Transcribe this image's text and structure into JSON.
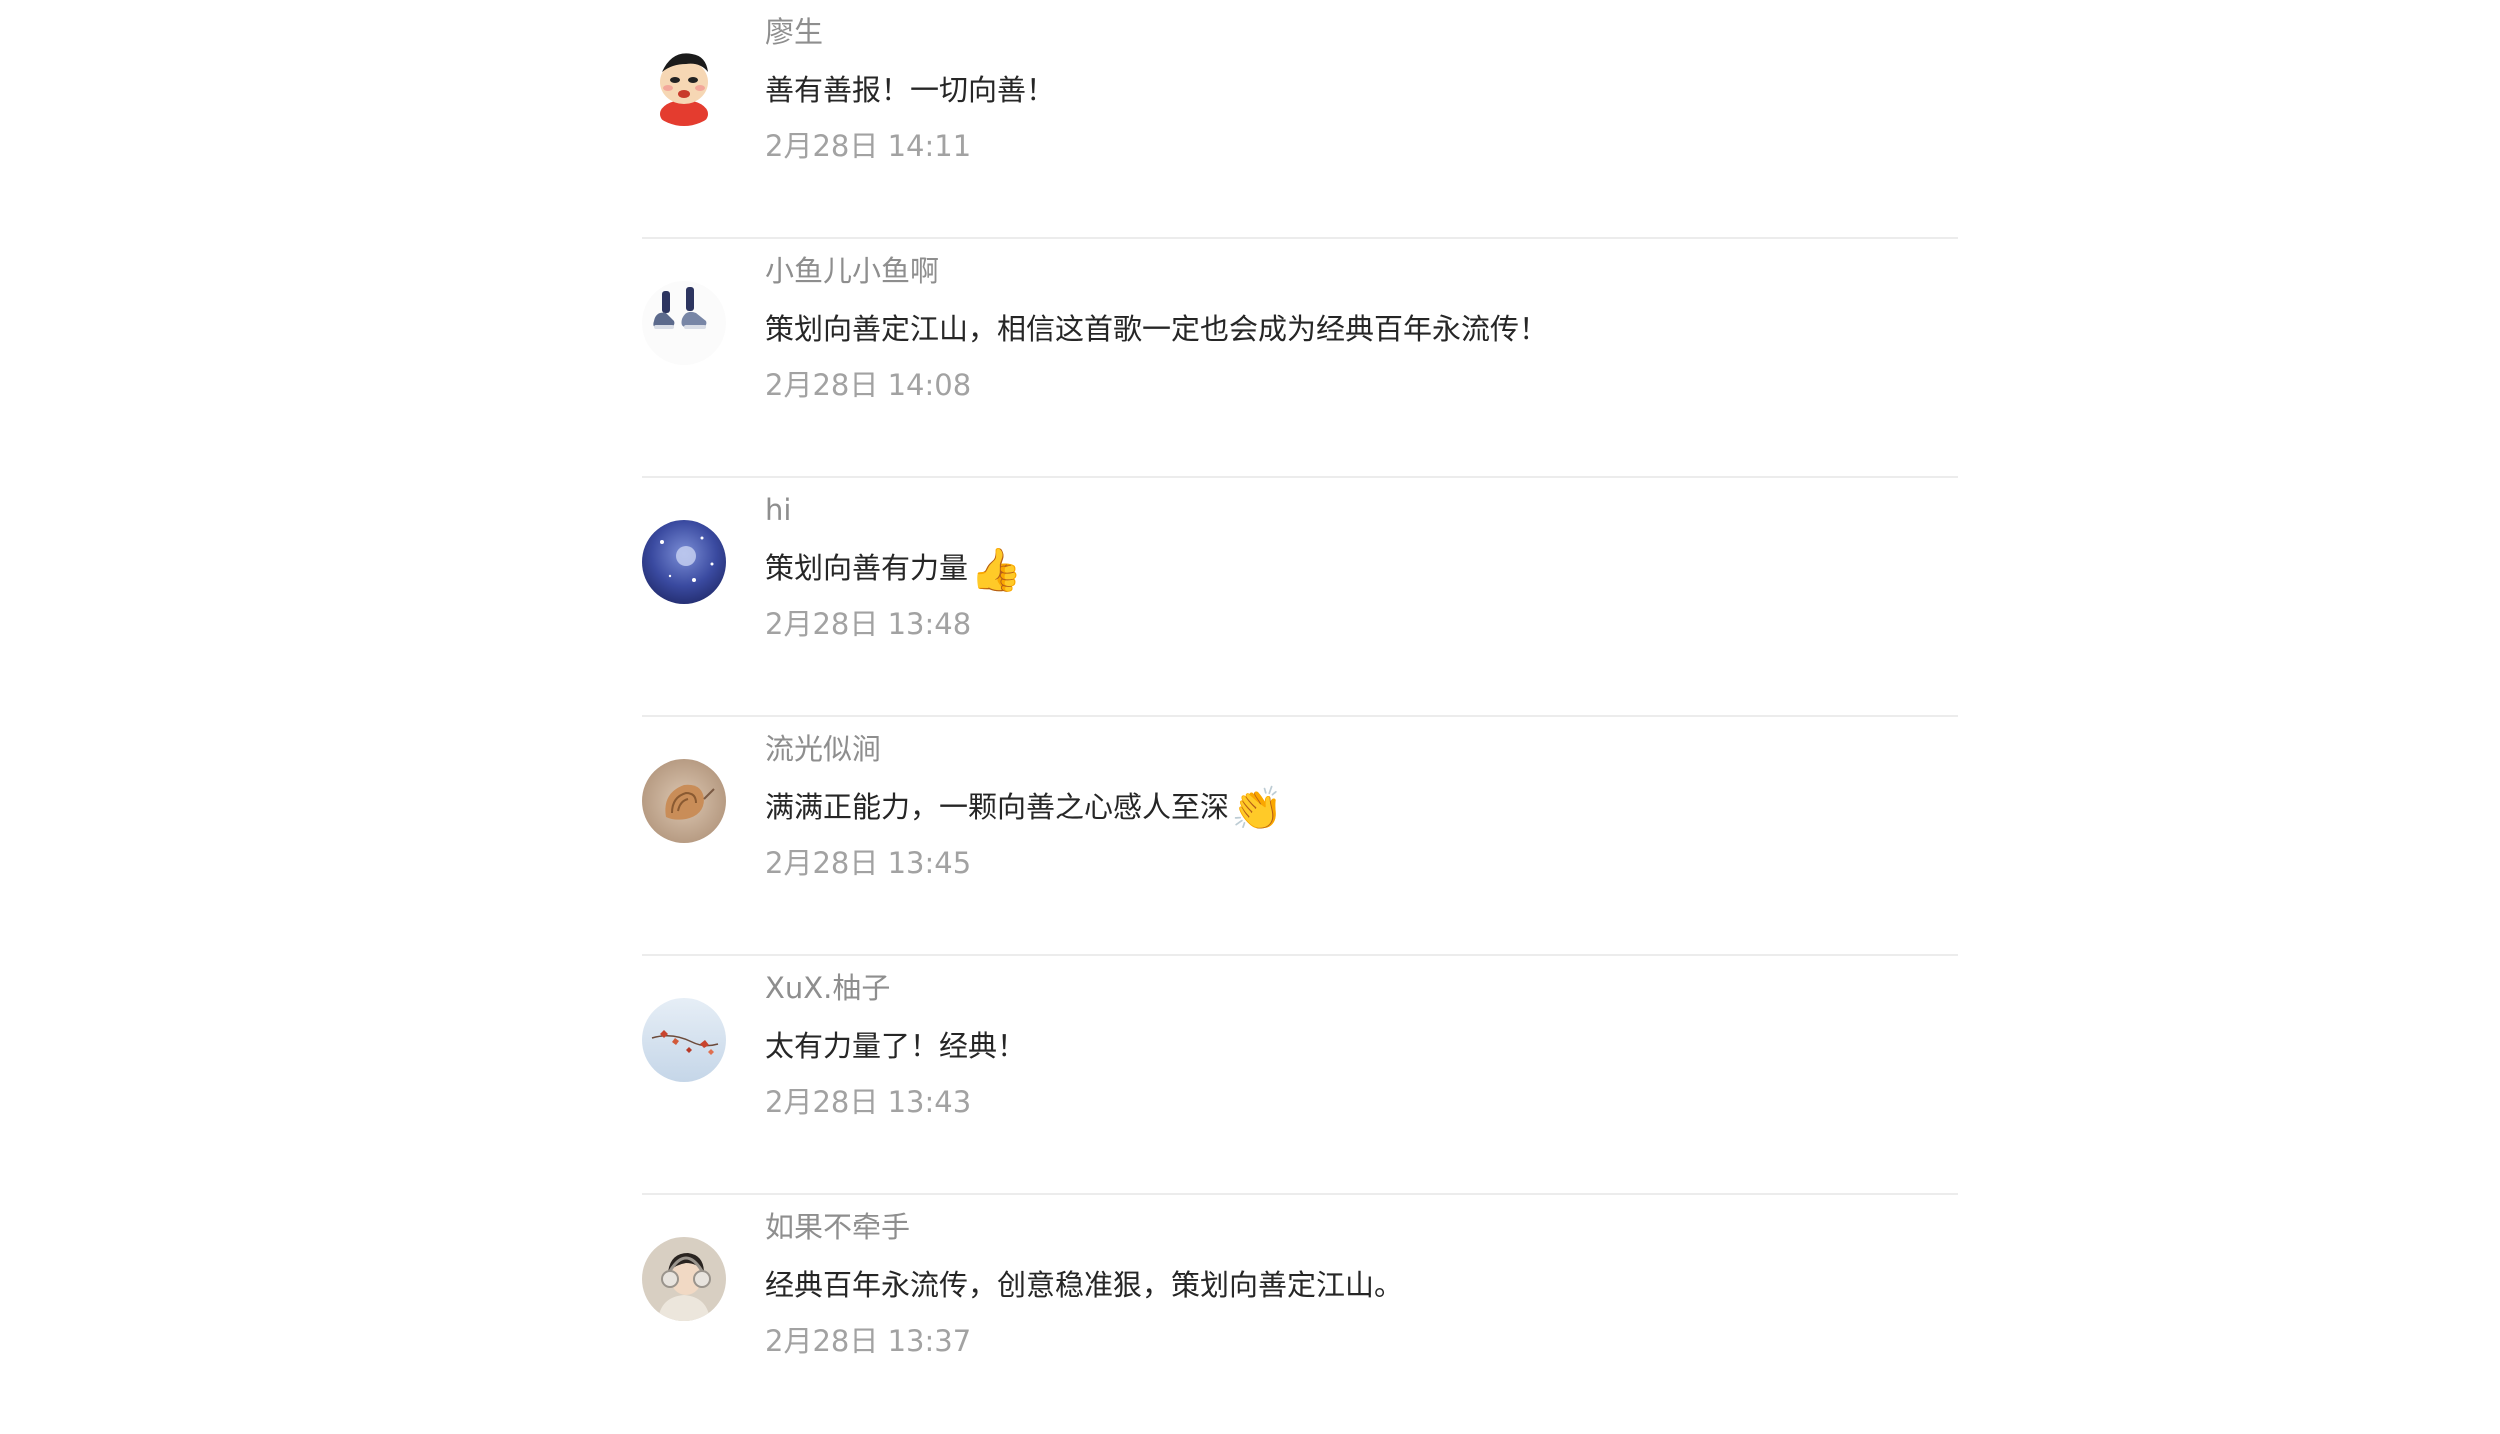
{
  "comments": [
    {
      "nickname": "廖生",
      "content": "善有善报！一切向善！",
      "emoji": "",
      "time": "2月28日 14:11",
      "avatar_icon": "cartoon-boy-avatar"
    },
    {
      "nickname": "小鱼儿小鱼啊",
      "content": "策划向善定江山，相信这首歌一定也会成为经典百年永流传！",
      "emoji": "",
      "time": "2月28日 14:08",
      "avatar_icon": "sneakers-avatar"
    },
    {
      "nickname": "hi",
      "content": "策划向善有力量",
      "emoji": "👍",
      "time": "2月28日 13:48",
      "avatar_icon": "night-sky-avatar"
    },
    {
      "nickname": "流光似涧",
      "content": "满满正能力，一颗向善之心感人至深",
      "emoji": "👏",
      "time": "2月28日 13:45",
      "avatar_icon": "seashell-avatar"
    },
    {
      "nickname": "XuX.柚子",
      "content": "太有力量了！经典！",
      "emoji": "",
      "time": "2月28日 13:43",
      "avatar_icon": "red-leaves-avatar"
    },
    {
      "nickname": "如果不牵手",
      "content": "经典百年永流传，创意稳准狠，策划向善定江山。",
      "emoji": "",
      "time": "2月28日 13:37",
      "avatar_icon": "girl-headphones-avatar"
    }
  ]
}
